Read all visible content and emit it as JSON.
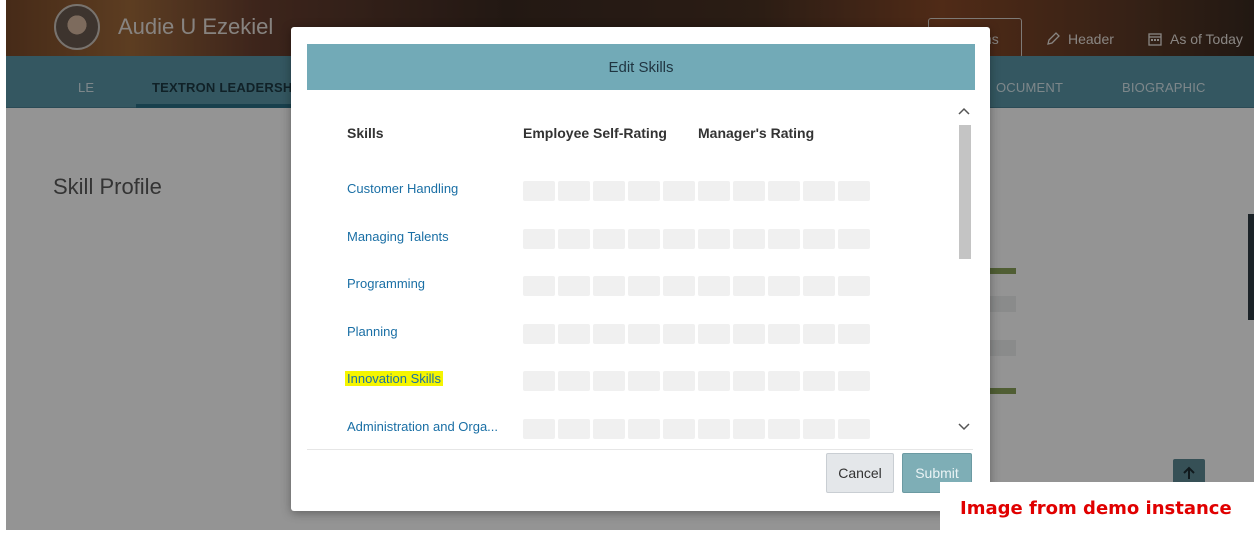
{
  "header": {
    "user_name": "Audie U Ezekiel",
    "actions_label": "ns",
    "header_link": "Header",
    "as_of_link": "As of Today"
  },
  "navbar": {
    "items": [
      "LE",
      "TEXTRON LEADERSH",
      "OCUMENT",
      "BIOGRAPHIC"
    ]
  },
  "page": {
    "title": "Skill Profile"
  },
  "dialog": {
    "title": "Edit Skills",
    "columns": {
      "skills": "Skills",
      "self_rating": "Employee Self-Rating",
      "manager_rating": "Manager's Rating"
    },
    "skills": [
      {
        "name": "Customer Handling",
        "highlighted": false
      },
      {
        "name": "Managing Talents",
        "highlighted": false
      },
      {
        "name": "Programming",
        "highlighted": false
      },
      {
        "name": "Planning",
        "highlighted": false
      },
      {
        "name": "Innovation Skills",
        "highlighted": true
      },
      {
        "name": "Administration and Orga...",
        "highlighted": false
      }
    ],
    "cancel_label": "Cancel",
    "submit_label": "Submit"
  },
  "caption": {
    "text": "Image from demo instance"
  },
  "colors": {
    "dialog_header": "#72aab7",
    "navbar": "#5b96a8",
    "link": "#1a6fa5",
    "highlight": "#f5f500",
    "caption": "#e00000"
  }
}
